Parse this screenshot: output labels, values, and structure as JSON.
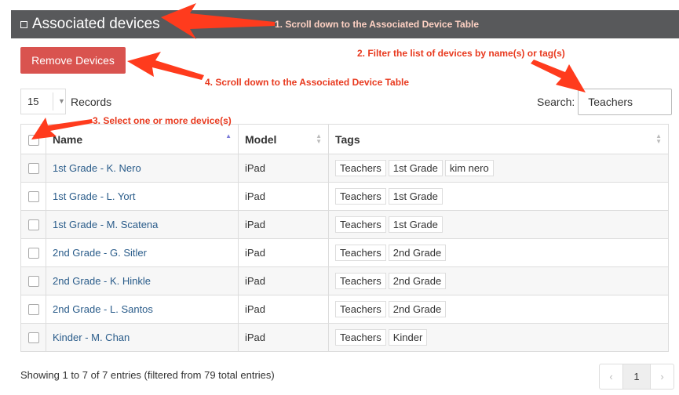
{
  "panel": {
    "title": "Associated devices"
  },
  "toolbar": {
    "remove_label": "Remove Devices"
  },
  "records": {
    "value": "15",
    "label": "Records"
  },
  "search": {
    "label": "Search:",
    "value": "Teachers"
  },
  "table": {
    "headers": {
      "name": "Name",
      "model": "Model",
      "tags": "Tags"
    },
    "rows": [
      {
        "name": "1st Grade - K. Nero",
        "model": "iPad",
        "tags": [
          "Teachers",
          "1st Grade",
          "kim nero"
        ]
      },
      {
        "name": "1st Grade - L. Yort",
        "model": "iPad",
        "tags": [
          "Teachers",
          "1st Grade"
        ]
      },
      {
        "name": "1st Grade - M. Scatena",
        "model": "iPad",
        "tags": [
          "Teachers",
          "1st Grade"
        ]
      },
      {
        "name": "2nd Grade - G. Sitler",
        "model": "iPad",
        "tags": [
          "Teachers",
          "2nd Grade"
        ]
      },
      {
        "name": "2nd Grade - K. Hinkle",
        "model": "iPad",
        "tags": [
          "Teachers",
          "2nd Grade"
        ]
      },
      {
        "name": "2nd Grade - L. Santos",
        "model": "iPad",
        "tags": [
          "Teachers",
          "2nd Grade"
        ]
      },
      {
        "name": "Kinder - M. Chan",
        "model": "iPad",
        "tags": [
          "Teachers",
          "Kinder"
        ]
      }
    ]
  },
  "footer": {
    "info": "Showing 1 to 7 of 7 entries (filtered from 79 total entries)"
  },
  "pagination": {
    "prev": "‹",
    "current": "1",
    "next": "›"
  },
  "annotations": {
    "a1": "1. Scroll down to the Associated Device Table",
    "a2": "2. Filter the list of devices by name(s) or tag(s)",
    "a3": "3. Select one or more device(s)",
    "a4": "4. Scroll down to the Associated Device Table"
  },
  "colors": {
    "header": "#58595b",
    "button": "#d9534f",
    "link": "#2a5c8a",
    "annotation": "#e8391e"
  },
  "icons": {
    "panel": "square-outline-icon",
    "records": "caret-down-icon",
    "sort": "sort-arrows-icon",
    "annotation": "red-arrow-icon"
  }
}
